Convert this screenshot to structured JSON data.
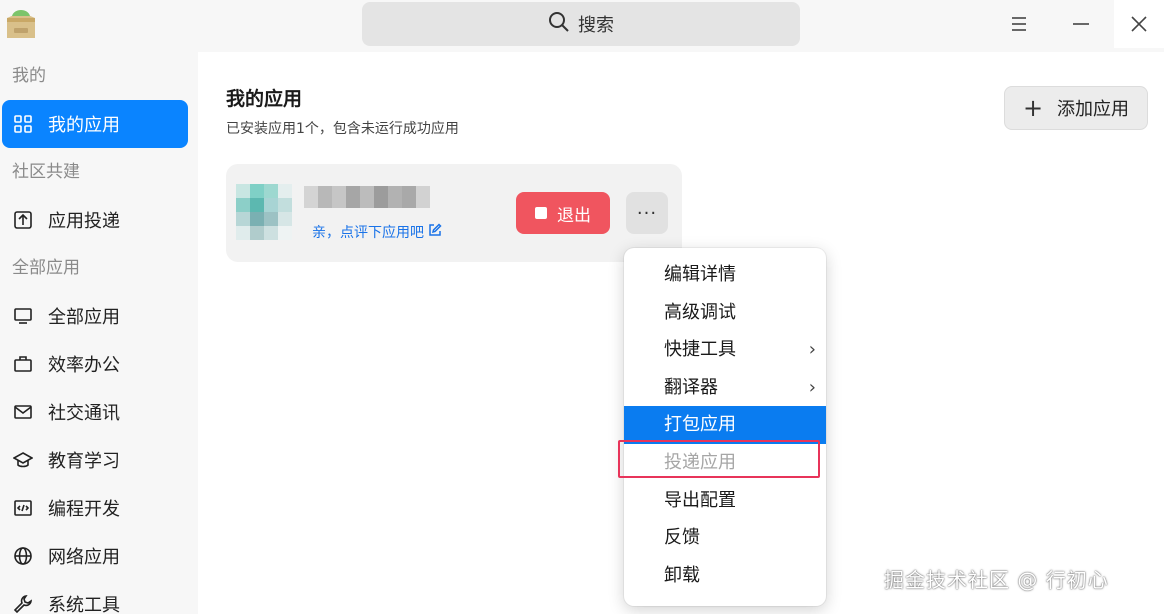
{
  "titlebar": {
    "search_label": "搜索",
    "icons": [
      "app-logo-icon",
      "search-icon",
      "menu-icon",
      "minimize-icon",
      "close-icon"
    ]
  },
  "sidebar": {
    "groups": [
      {
        "label": "我的"
      },
      {
        "label": "社区共建"
      },
      {
        "label": "全部应用"
      }
    ],
    "items": [
      {
        "label": "我的应用",
        "icon": "grid-icon",
        "active": true
      },
      {
        "label": "应用投递",
        "icon": "upload-box-icon"
      },
      {
        "label": "全部应用",
        "icon": "monitor-icon"
      },
      {
        "label": "效率办公",
        "icon": "briefcase-icon"
      },
      {
        "label": "社交通讯",
        "icon": "mail-icon"
      },
      {
        "label": "教育学习",
        "icon": "graduation-cap-icon"
      },
      {
        "label": "编程开发",
        "icon": "code-icon"
      },
      {
        "label": "网络应用",
        "icon": "globe-icon"
      },
      {
        "label": "系统工具",
        "icon": "wrench-icon"
      }
    ]
  },
  "main": {
    "title": "我的应用",
    "subtitle": "已安装应用1个，包含未运行成功应用",
    "add_button": "添加应用",
    "app_card": {
      "review_link": "亲，点评下应用吧",
      "quit_button": "退出",
      "more_button": "···"
    }
  },
  "context_menu": {
    "items": [
      {
        "label": "编辑详情"
      },
      {
        "label": "高级调试"
      },
      {
        "label": "快捷工具",
        "submenu": true
      },
      {
        "label": "翻译器",
        "submenu": true
      },
      {
        "label": "打包应用",
        "highlighted": true
      },
      {
        "label": "投递应用",
        "disabled": true
      },
      {
        "label": "导出配置"
      },
      {
        "label": "反馈"
      },
      {
        "label": "卸载"
      }
    ]
  },
  "watermark": "掘金技术社区 @ 行初心",
  "colors": {
    "accent": "#0a84ff",
    "quit": "#f0555f",
    "link": "#1a73e8",
    "highlight_box": "#e8345a"
  }
}
